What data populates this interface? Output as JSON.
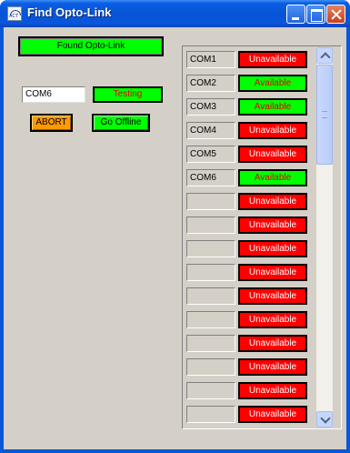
{
  "window": {
    "title": "Find Opto-Link",
    "icon_text": "ACT"
  },
  "status": {
    "banner": "Found Opto-Link",
    "port": "COM6",
    "testing": "Testing"
  },
  "buttons": {
    "abort": "ABORT",
    "offline": "Go Offline"
  },
  "ports": [
    {
      "name": "COM1",
      "status": "Unavailable"
    },
    {
      "name": "COM2",
      "status": "Available"
    },
    {
      "name": "COM3",
      "status": "Available"
    },
    {
      "name": "COM4",
      "status": "Unavailable"
    },
    {
      "name": "COM5",
      "status": "Unavailable"
    },
    {
      "name": "COM6",
      "status": "Available"
    },
    {
      "name": "",
      "status": "Unavailable"
    },
    {
      "name": "",
      "status": "Unavailable"
    },
    {
      "name": "",
      "status": "Unavailable"
    },
    {
      "name": "",
      "status": "Unavailable"
    },
    {
      "name": "",
      "status": "Unavailable"
    },
    {
      "name": "",
      "status": "Unavailable"
    },
    {
      "name": "",
      "status": "Unavailable"
    },
    {
      "name": "",
      "status": "Unavailable"
    },
    {
      "name": "",
      "status": "Unavailable"
    },
    {
      "name": "",
      "status": "Unavailable"
    }
  ],
  "colors": {
    "available": "#00ff00",
    "unavailable": "#ff0000",
    "abort": "#ff9900"
  }
}
